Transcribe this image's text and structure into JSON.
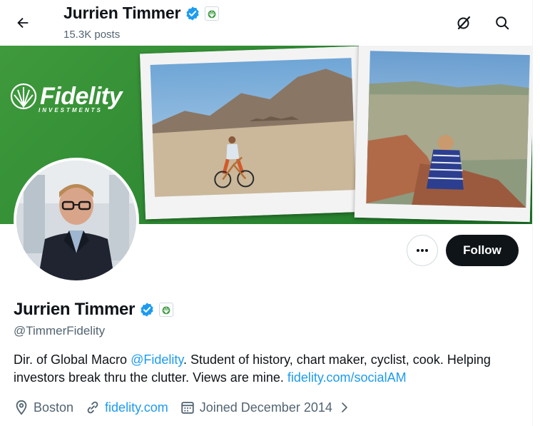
{
  "header": {
    "name": "Jurrien Timmer",
    "posts": "15.3K posts"
  },
  "banner": {
    "logo_text": "Fidelity",
    "logo_subtext": "INVESTMENTS"
  },
  "actions": {
    "follow_label": "Follow"
  },
  "profile": {
    "name": "Jurrien Timmer",
    "handle": "@TimmerFidelity",
    "bio": {
      "part1": "Dir. of Global Macro ",
      "mention": "@Fidelity",
      "part2": ". Student of history, chart maker, cyclist, cook. Helping investors break thru the clutter. Views are mine. ",
      "link": "fidelity.com/socialAM"
    },
    "location": "Boston",
    "website": "fidelity.com",
    "joined": "Joined December 2014"
  },
  "colors": {
    "accent": "#1d9bf0",
    "text": "#0f1419",
    "muted": "#536471",
    "banner_green": "#2f8a33",
    "follow_bg": "#0f1419"
  },
  "icons": [
    "back-arrow-icon",
    "verified-badge-icon",
    "fidelity-affiliate-icon",
    "grok-icon",
    "search-icon",
    "more-dots-icon",
    "location-pin-icon",
    "link-icon",
    "calendar-icon",
    "chevron-right-icon"
  ]
}
